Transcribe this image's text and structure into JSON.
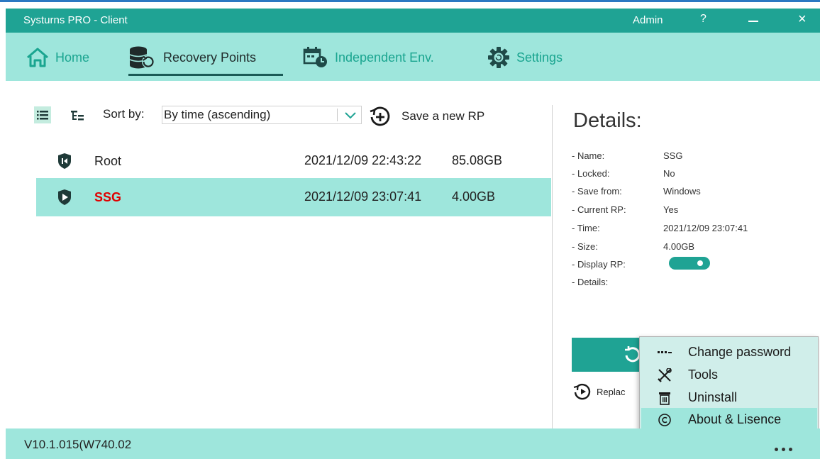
{
  "window": {
    "title": "Systurns PRO - Client",
    "admin_label": "Admin",
    "help_label": "?",
    "close_label": "×"
  },
  "nav": {
    "home": "Home",
    "recovery_points": "Recovery Points",
    "independent_env": "Independent Env.",
    "settings": "Settings",
    "active": "recovery_points"
  },
  "toolbar": {
    "sort_by_label": "Sort by:",
    "sort_value": "By time (ascending)",
    "save_new_rp": "Save a new RP",
    "view_mode": "list"
  },
  "recovery_points": [
    {
      "name": "Root",
      "time": "2021/12/09 22:43:22",
      "size": "85.08GB",
      "icon": "shield-rewind-icon",
      "selected": false,
      "current": false
    },
    {
      "name": "SSG",
      "time": "2021/12/09 23:07:41",
      "size": "4.00GB",
      "icon": "shield-play-icon",
      "selected": true,
      "current": true
    }
  ],
  "details": {
    "title": "Details:",
    "fields": [
      {
        "key": "- Name:",
        "value": "SSG"
      },
      {
        "key": "- Locked:",
        "value": "No"
      },
      {
        "key": "- Save from:",
        "value": "Windows"
      },
      {
        "key": "- Current RP:",
        "value": "Yes"
      },
      {
        "key": "- Time:",
        "value": "2021/12/09 23:07:41"
      },
      {
        "key": "- Size:",
        "value": "4.00GB"
      },
      {
        "key": "- Display RP:",
        "value": ""
      },
      {
        "key": "- Details:",
        "value": ""
      }
    ],
    "display_rp_on": true,
    "replace_label": "Replac"
  },
  "menu": {
    "items": [
      {
        "label": "Change password",
        "icon": "password-dots-icon",
        "highlighted": false
      },
      {
        "label": "Tools",
        "icon": "tools-icon",
        "highlighted": false
      },
      {
        "label": "Uninstall",
        "icon": "trash-icon",
        "highlighted": false
      },
      {
        "label": "About & Lisence",
        "icon": "copyright-icon",
        "highlighted": true
      }
    ]
  },
  "status": {
    "version": "V10.1.015(W740.02"
  },
  "colors": {
    "accent": "#1fa394",
    "nav_bg": "#9ee6dc",
    "selected_row": "#9ee6dc",
    "current_name": "#e00000",
    "menu_bg": "#d0eeea"
  }
}
